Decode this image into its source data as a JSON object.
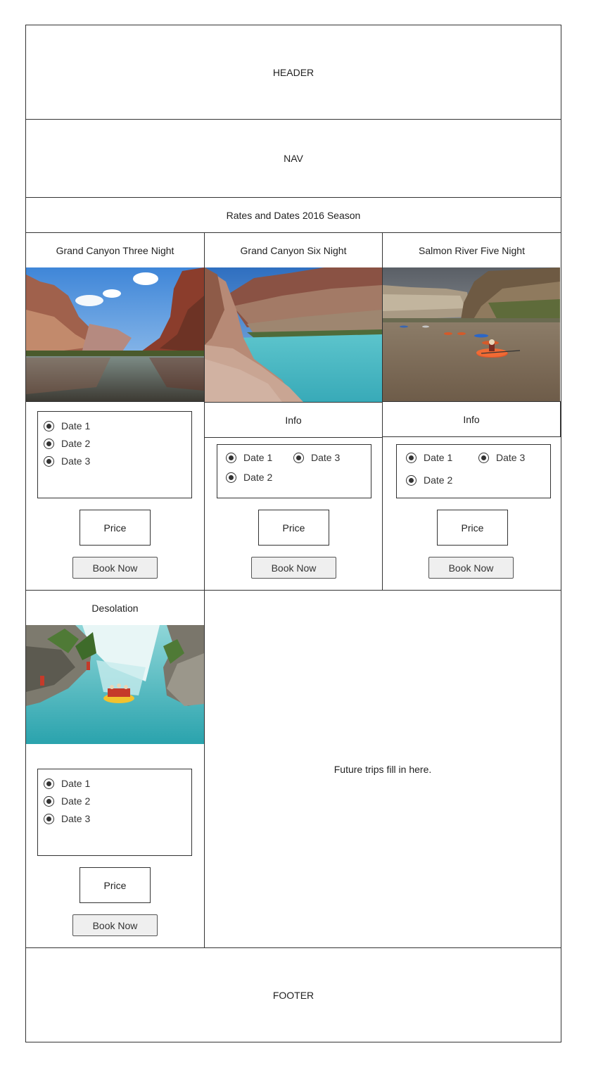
{
  "header": {
    "label": "HEADER"
  },
  "nav": {
    "label": "NAV"
  },
  "section": {
    "title": "Rates and Dates 2016 Season"
  },
  "trips": [
    {
      "title": "Grand Canyon Three Night",
      "image": "grand-canyon-river-photo",
      "dates": [
        "Date 1",
        "Date 2",
        "Date 3"
      ],
      "price_label": "Price",
      "book_label": "Book Now"
    },
    {
      "title": "Grand Canyon Six Night",
      "image": "little-colorado-turquoise-river-photo",
      "info_label": "Info",
      "dates": [
        "Date 1",
        "Date 2",
        "Date 3"
      ],
      "price_label": "Price",
      "book_label": "Book Now"
    },
    {
      "title": "Salmon River Five Night",
      "image": "kayakers-on-river-photo",
      "info_label": "Info",
      "dates": [
        "Date 1",
        "Date 2",
        "Date 3"
      ],
      "price_label": "Price",
      "book_label": "Book Now"
    },
    {
      "title": "Desolation",
      "image": "whitewater-rafting-photo",
      "dates": [
        "Date 1",
        "Date 2",
        "Date 3"
      ],
      "price_label": "Price",
      "book_label": "Book Now"
    }
  ],
  "future": {
    "text": "Future trips fill in here."
  },
  "footer": {
    "label": "FOOTER"
  }
}
